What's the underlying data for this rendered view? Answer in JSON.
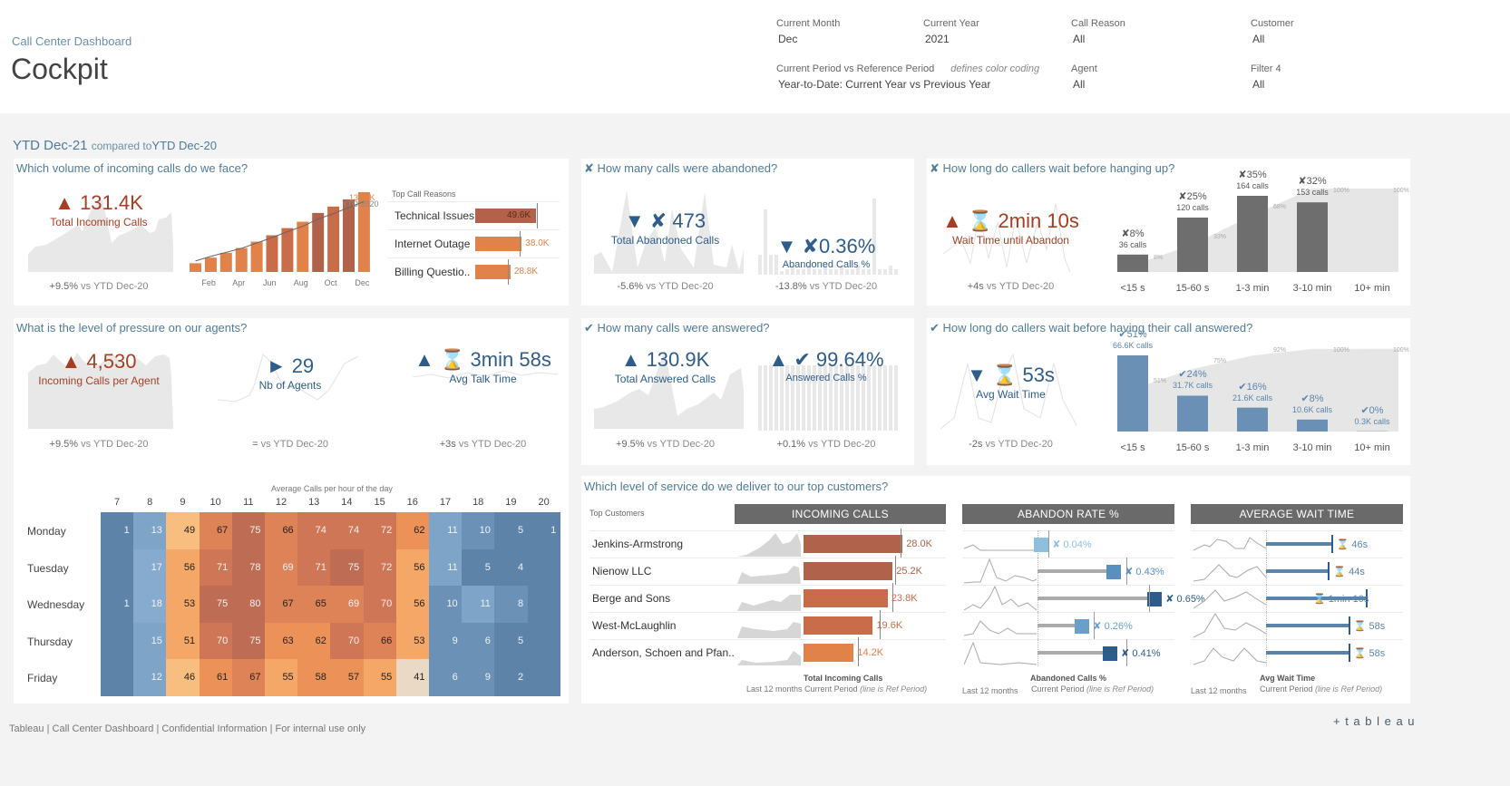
{
  "header": {
    "subtitle": "Call Center Dashboard",
    "title": "Cockpit",
    "filters": [
      {
        "label": "Current Month",
        "value": "Dec"
      },
      {
        "label": "Current Year",
        "value": "2021"
      },
      {
        "label": "Call Reason",
        "value": "All"
      },
      {
        "label": "Customer",
        "value": "All"
      },
      {
        "label": "Current Period vs Reference Period",
        "note": "defines color coding",
        "value": "Year-to-Date: Current Year vs Previous Year"
      },
      {
        "label": "Agent",
        "value": "All"
      },
      {
        "label": "Filter 4",
        "value": "All"
      }
    ]
  },
  "period": {
    "current": "YTD Dec-21",
    "compared": "compared to",
    "reference": "YTD Dec-20"
  },
  "volume": {
    "title": "Which volume of incoming calls do we face?",
    "kpi_value": "▲ 131.4K",
    "kpi_label": "Total Incoming Calls",
    "cmp_value": "+9.5%",
    "cmp_text": "vs YTD Dec-20",
    "cum_label_value": "131.4K",
    "cum_label_ref": "YTD 2020",
    "months": [
      "Feb",
      "Apr",
      "Jun",
      "Aug",
      "Oct",
      "Dec"
    ],
    "cumulative_fraction": [
      0.11,
      0.18,
      0.24,
      0.3,
      0.38,
      0.46,
      0.55,
      0.63,
      0.74,
      0.82,
      0.91,
      1.0
    ],
    "reasons_title": "Top Call Reasons",
    "reasons": [
      {
        "name": "Technical Issues",
        "value": "49.6K",
        "num": 49.6,
        "ref": 50
      },
      {
        "name": "Internet Outage",
        "value": "38.0K",
        "num": 38.0,
        "ref": 36
      },
      {
        "name": "Billing Questio..",
        "value": "28.8K",
        "num": 28.8,
        "ref": 27
      }
    ]
  },
  "abandoned": {
    "title": "✘ How many calls were abandoned?",
    "kpi1_value": "▼ ✘ 473",
    "kpi1_label": "Total Abandoned Calls",
    "cmp1_value": "-5.6%",
    "cmp1_text": "vs YTD Dec-20",
    "kpi2_value": "▼ ✘0.36%",
    "kpi2_label": "Abandoned Calls %",
    "cmp2_value": "-13.8%",
    "cmp2_text": "vs YTD Dec-20"
  },
  "hangup": {
    "title": "✘ How long do callers wait before hanging up?",
    "kpi_value": "▲ ⌛ 2min 10s",
    "kpi_label": "Wait Time until Abandon",
    "cmp_value": "+4s",
    "cmp_text": "vs YTD Dec-20",
    "buckets": [
      {
        "label": "<15 s",
        "pct": "✘8%",
        "calls": "36 calls",
        "share": 0.08,
        "cum": "8%"
      },
      {
        "label": "15-60 s",
        "pct": "✘25%",
        "calls": "120 calls",
        "share": 0.25,
        "cum": "33%"
      },
      {
        "label": "1-3 min",
        "pct": "✘35%",
        "calls": "164 calls",
        "share": 0.35,
        "cum": "68%"
      },
      {
        "label": "3-10 min",
        "pct": "✘32%",
        "calls": "153 calls",
        "share": 0.32,
        "cum": "100%"
      },
      {
        "label": "10+ min",
        "pct": "",
        "calls": "",
        "share": 0,
        "cum": "100%"
      }
    ]
  },
  "pressure": {
    "title": "What is the level of pressure on our agents?",
    "kpi1_value": "▲ 4,530",
    "kpi1_label": "Incoming Calls per Agent",
    "cmp1_value": "+9.5%",
    "cmp1_text": "vs YTD Dec-20",
    "kpi2_value": "► 29",
    "kpi2_label": "Nb of Agents",
    "cmp2_value": "=",
    "cmp2_text": "vs YTD Dec-20",
    "kpi3_value": "▲ ⌛ 3min 58s",
    "kpi3_label": "Avg Talk Time",
    "cmp3_value": "+3s",
    "cmp3_text": "vs YTD Dec-20"
  },
  "answered": {
    "title": "✔ How many calls were answered?",
    "kpi1_value": "▲ 130.9K",
    "kpi1_label": "Total Answered Calls",
    "cmp1_value": "+9.5%",
    "cmp1_text": "vs YTD Dec-20",
    "kpi2_value": "▲ ✔ 99.64%",
    "kpi2_label": "Answered Calls %",
    "cmp2_value": "+0.1%",
    "cmp2_text": "vs YTD Dec-20"
  },
  "waitanswer": {
    "title": "✔ How long do callers wait before having their call answered?",
    "kpi_value": "▼ ⌛ 53s",
    "kpi_label": "Avg Wait Time",
    "cmp_value": "-2s",
    "cmp_text": "vs YTD Dec-20",
    "buckets": [
      {
        "label": "<15 s",
        "pct": "✔51%",
        "calls": "66.6K calls",
        "share": 0.51,
        "cum": "51%"
      },
      {
        "label": "15-60 s",
        "pct": "✔24%",
        "calls": "31.7K calls",
        "share": 0.24,
        "cum": "75%"
      },
      {
        "label": "1-3 min",
        "pct": "✔16%",
        "calls": "21.6K calls",
        "share": 0.16,
        "cum": "92%"
      },
      {
        "label": "3-10 min",
        "pct": "✔8%",
        "calls": "10.6K calls",
        "share": 0.08,
        "cum": "100%"
      },
      {
        "label": "10+ min",
        "pct": "✔0%",
        "calls": "0.3K calls",
        "share": 0.002,
        "cum": "100%"
      }
    ]
  },
  "heatmap": {
    "title": "Average Calls per hour of the day",
    "hours": [
      "7",
      "8",
      "9",
      "10",
      "11",
      "12",
      "13",
      "14",
      "15",
      "16",
      "17",
      "18",
      "19",
      "20"
    ],
    "days": [
      "Monday",
      "Tuesday",
      "Wednesday",
      "Thursday",
      "Friday"
    ],
    "values": [
      [
        1,
        13,
        49,
        67,
        75,
        66,
        74,
        74,
        72,
        62,
        11,
        10,
        5,
        1
      ],
      [
        null,
        17,
        56,
        71,
        78,
        69,
        71,
        75,
        72,
        56,
        11,
        5,
        4,
        null
      ],
      [
        1,
        18,
        53,
        75,
        80,
        67,
        65,
        69,
        70,
        56,
        10,
        11,
        8,
        null
      ],
      [
        null,
        15,
        51,
        70,
        75,
        63,
        62,
        70,
        66,
        53,
        9,
        6,
        5,
        null
      ],
      [
        null,
        12,
        46,
        61,
        67,
        55,
        58,
        57,
        55,
        41,
        6,
        9,
        2,
        null
      ]
    ]
  },
  "customers": {
    "title": "Which level of service do we deliver to our top customers?",
    "col_label": "Top Customers",
    "col_incoming": "INCOMING CALLS",
    "col_abandon": "ABANDON RATE %",
    "col_wait": "AVERAGE WAIT TIME",
    "rows": [
      {
        "name": "Jenkins-Armstrong",
        "calls": "28.0K",
        "calls_num": 28.0,
        "calls_ref": 27.5,
        "abandon": "✘ 0.04%",
        "abandon_num": 0.04,
        "abandon_ref": 0.06,
        "wait": "⌛ 46s",
        "wait_s": 46
      },
      {
        "name": "Nienow LLC",
        "calls": "25.2K",
        "calls_num": 25.2,
        "calls_ref": 25.8,
        "abandon": "✘ 0.43%",
        "abandon_num": 0.43,
        "abandon_ref": 0.48,
        "wait": "⌛ 44s",
        "wait_s": 44
      },
      {
        "name": "Berge and Sons",
        "calls": "23.8K",
        "calls_num": 23.8,
        "calls_ref": 25.0,
        "abandon": "✘ 0.65%",
        "abandon_num": 0.65,
        "abandon_ref": 0.6,
        "wait": "⌛ 1min 10s",
        "wait_s": 70
      },
      {
        "name": "West-McLaughlin",
        "calls": "19.6K",
        "calls_num": 19.6,
        "calls_ref": 21.5,
        "abandon": "✘ 0.26%",
        "abandon_num": 0.26,
        "abandon_ref": 0.3,
        "wait": "⌛ 58s",
        "wait_s": 58
      },
      {
        "name": "Anderson, Schoen and Pfan..",
        "calls": "14.2K",
        "calls_num": 14.2,
        "calls_ref": 15.5,
        "abandon": "✘ 0.41%",
        "abandon_num": 0.41,
        "abandon_ref": 0.48,
        "wait": "⌛ 58s",
        "wait_s": 58
      }
    ],
    "foot_incoming": "Total Incoming Calls",
    "foot_abandon": "Abandoned Calls %",
    "foot_wait": "Avg Wait Time",
    "foot_last12": "Last 12 months",
    "foot_current": "Current Period",
    "foot_ref": "(line is Ref Period)"
  },
  "footer": {
    "text": "Tableau | Call Center Dashboard | Confidential Information | For internal use only",
    "logo": "+ t a b l e a u"
  },
  "colors": {
    "red": "#a63f22",
    "blue": "#2e5d8b",
    "orange": "#e1824b",
    "brown": "#b0624a",
    "grey": "#707070",
    "steel": "#6a90b5"
  }
}
